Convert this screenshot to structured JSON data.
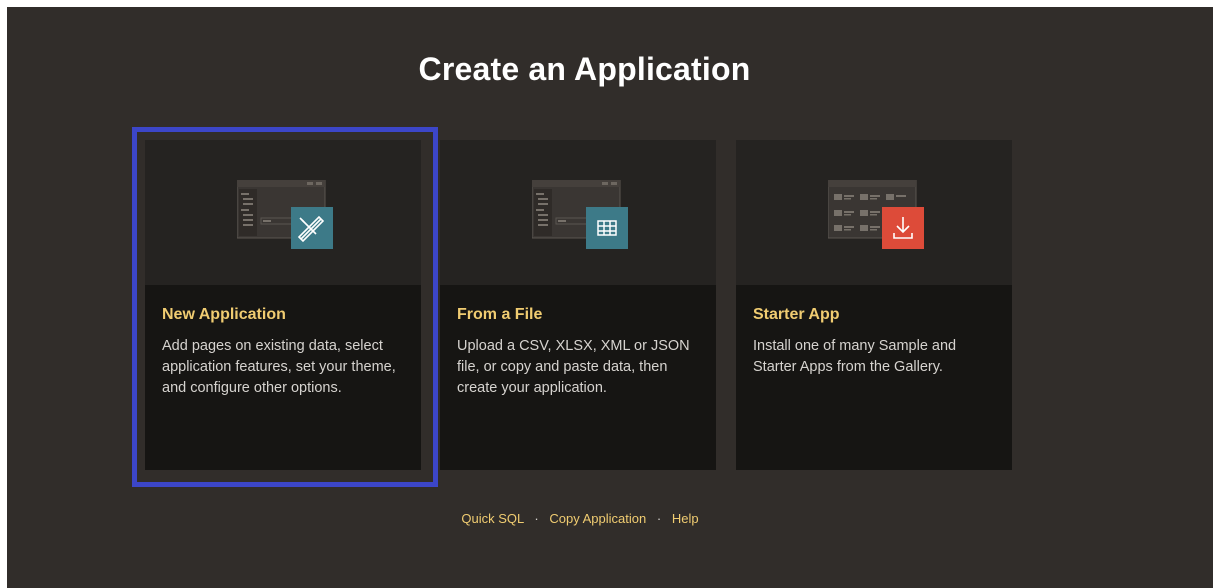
{
  "page": {
    "title": "Create an Application"
  },
  "cards": [
    {
      "title": "New Application",
      "description": "Add pages on existing data, select application features, set your theme, and configure other options.",
      "icon": "wand-icon",
      "badge_color": "#3d7a88"
    },
    {
      "title": "From a File",
      "description": "Upload a CSV, XLSX, XML or JSON file, or copy and paste data, then create your application.",
      "icon": "table-icon",
      "badge_color": "#3d7a88"
    },
    {
      "title": "Starter App",
      "description": "Install one of many Sample and Starter Apps from the Gallery.",
      "icon": "download-icon",
      "badge_color": "#dd4b39"
    }
  ],
  "links": [
    {
      "label": "Quick SQL"
    },
    {
      "label": "Copy Application"
    },
    {
      "label": "Help"
    }
  ],
  "link_separator": "·",
  "colors": {
    "background": "#312d2a",
    "card": "#161513",
    "accent_title": "#f0cc71",
    "focus": "#3c46c8"
  }
}
